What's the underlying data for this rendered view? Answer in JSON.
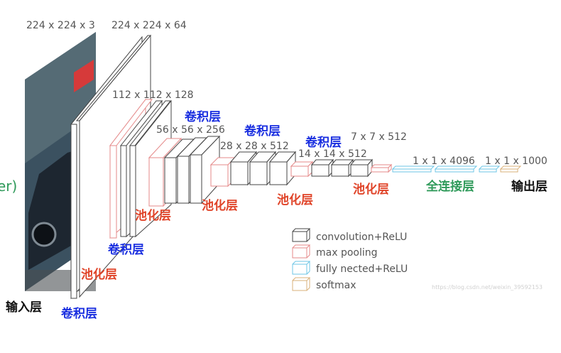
{
  "dims": {
    "input": "224 x 224 x 3",
    "conv1": "224 x 224 x 64",
    "conv2": "112 x 112 x 128",
    "conv3": "56 x 56 x 256",
    "conv4": "28 x 28 x 512",
    "conv5": "14 x 14 x 512",
    "pool5": "7 x 7 x 512",
    "fc": "1 x 1 x 4096",
    "out": "1 x 1 x 1000"
  },
  "labels": {
    "input_layer": "输入层",
    "conv_1": "卷积层",
    "pool_1": "池化层",
    "conv_2": "卷积层",
    "pool_2": "池化层",
    "conv_3": "卷积层",
    "pool_3": "池化层",
    "conv_4": "卷积层",
    "pool_4": "池化层",
    "conv_5": "卷积层",
    "pool_5": "池化层",
    "fully_connected": "全连接层",
    "output_layer": "输出层",
    "edge_fragment": "er)"
  },
  "legend": [
    {
      "label": "convolution+ReLU",
      "color": "#444444"
    },
    {
      "label": "max pooling",
      "color": "#e58a8a"
    },
    {
      "label": "fully nected+ReLU",
      "color": "#6ec6e6"
    },
    {
      "label": "softmax",
      "color": "#d9b07a"
    }
  ],
  "watermark": "https://blog.csdn.net/weixin_39592153",
  "colors": {
    "blue_label": "#1a2fe0",
    "red_label": "#e0452a",
    "green_label": "#2f9a5a",
    "black_label": "#111111",
    "dim_text": "#555555",
    "conv_edge": "#444444",
    "pool_edge": "#e58a8a",
    "fc_edge": "#6ec6e6",
    "softmax_edge": "#d9b07a"
  }
}
